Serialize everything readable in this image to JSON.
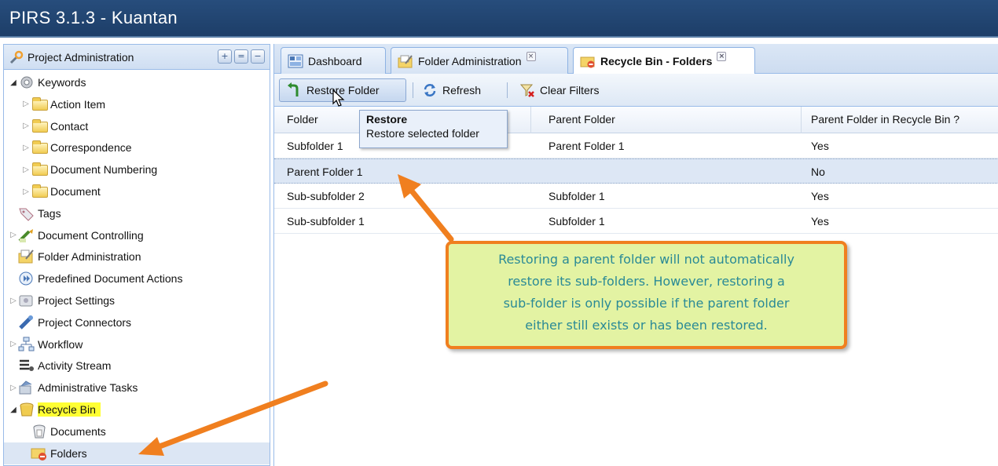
{
  "app": {
    "title": "PIRS 3.1.3  -  Kuantan"
  },
  "left_panel": {
    "title": "Project Administration",
    "header_buttons": [
      "add",
      "collapse",
      "minimize"
    ],
    "tree": [
      {
        "label": "Keywords",
        "icon": "gear-icon",
        "level": 0,
        "expanded": true
      },
      {
        "label": "Action Item",
        "icon": "folder-icon",
        "level": 1,
        "expanded": false
      },
      {
        "label": "Contact",
        "icon": "folder-icon",
        "level": 1,
        "expanded": false
      },
      {
        "label": "Correspondence",
        "icon": "folder-icon",
        "level": 1,
        "expanded": false
      },
      {
        "label": "Document Numbering",
        "icon": "folder-icon",
        "level": 1,
        "expanded": false
      },
      {
        "label": "Document",
        "icon": "folder-icon",
        "level": 1,
        "expanded": false
      },
      {
        "label": "Tags",
        "icon": "tag-icon",
        "level": 0
      },
      {
        "label": "Document Controlling",
        "icon": "document-controlling-icon",
        "level": 0,
        "expanded": false
      },
      {
        "label": "Folder Administration",
        "icon": "folder-admin-icon",
        "level": 0
      },
      {
        "label": "Predefined Document Actions",
        "icon": "play-icon",
        "level": 0
      },
      {
        "label": "Project Settings",
        "icon": "settings-box-icon",
        "level": 0,
        "expanded": false
      },
      {
        "label": "Project Connectors",
        "icon": "connector-icon",
        "level": 0
      },
      {
        "label": "Workflow",
        "icon": "workflow-icon",
        "level": 0,
        "expanded": false
      },
      {
        "label": "Activity Stream",
        "icon": "activity-stream-icon",
        "level": 0
      },
      {
        "label": "Administrative Tasks",
        "icon": "tasks-icon",
        "level": 0,
        "expanded": false
      },
      {
        "label": "Recycle Bin",
        "icon": "recycle-bin-icon",
        "level": 0,
        "expanded": true,
        "highlighted": true
      },
      {
        "label": "Documents",
        "icon": "recycle-documents-icon",
        "level": 1
      },
      {
        "label": "Folders",
        "icon": "recycle-folders-icon",
        "level": 1,
        "selected": true
      }
    ]
  },
  "tabs": [
    {
      "label": "Dashboard",
      "icon": "dashboard-icon",
      "closable": false,
      "active": false
    },
    {
      "label": "Folder Administration",
      "icon": "folder-admin-icon",
      "closable": true,
      "active": false
    },
    {
      "label": "Recycle Bin - Folders",
      "icon": "recycle-folders-icon",
      "closable": true,
      "active": true
    }
  ],
  "toolbar": {
    "restore_label": "Restore Folder",
    "refresh_label": "Refresh",
    "clear_filters_label": "Clear Filters"
  },
  "tooltip": {
    "title": "Restore",
    "body": "Restore selected folder"
  },
  "grid": {
    "columns": [
      "Folder",
      "Parent Folder",
      "Parent Folder in Recycle Bin ?"
    ],
    "rows": [
      {
        "folder": "Subfolder 1",
        "parent": "Parent Folder 1",
        "in_bin": "Yes",
        "selected": false
      },
      {
        "folder": "Parent Folder 1",
        "parent": "",
        "in_bin": "No",
        "selected": true
      },
      {
        "folder": "Sub-subfolder 2",
        "parent": "Subfolder 1",
        "in_bin": "Yes",
        "selected": false
      },
      {
        "folder": "Sub-subfolder 1",
        "parent": "Subfolder 1",
        "in_bin": "Yes",
        "selected": false
      }
    ]
  },
  "callout": {
    "lines": [
      "Restoring a parent folder will not automatically",
      "restore its sub-folders. However, restoring a",
      "sub-folder is only possible if the parent folder",
      "either still exists or has been restored."
    ]
  },
  "colors": {
    "title_bar": "#1f4270",
    "callout_bg": "#e3f3a3",
    "callout_border": "#f07f1f",
    "callout_text": "#2a8a96",
    "highlight": "#ffff33",
    "arrow": "#f07f1f"
  }
}
